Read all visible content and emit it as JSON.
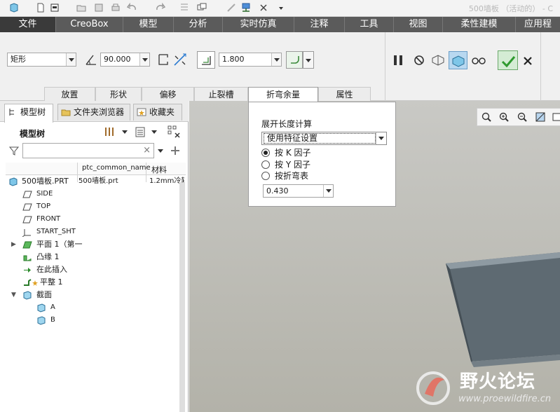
{
  "window": {
    "title": "500墙板 （活动的） - C"
  },
  "ribbon_tabs": [
    "文件",
    "CreoBox",
    "模型",
    "分析",
    "实时仿真",
    "注释",
    "工具",
    "视图",
    "柔性建模",
    "应用程"
  ],
  "toolbar": {
    "shape_select": "矩形",
    "angle_value": "90.000",
    "thickness_value": "1.800",
    "subtabs": [
      "放置",
      "形状",
      "偏移",
      "止裂槽",
      "折弯余量",
      "属性"
    ]
  },
  "left_panel": {
    "tabs": [
      "模型树",
      "文件夹浏览器",
      "收藏夹"
    ],
    "title": "模型树",
    "filter_clear": "×",
    "columns": [
      "ptc_common_name",
      "材料"
    ],
    "rows": [
      {
        "label": "500墙板.PRT",
        "name": "500墙板.prt",
        "material": "1.2mm冷轧",
        "expander": ""
      },
      {
        "label": "SIDE",
        "name": "",
        "material": "",
        "expander": ""
      },
      {
        "label": "TOP",
        "name": "",
        "material": "",
        "expander": ""
      },
      {
        "label": "FRONT",
        "name": "",
        "material": "",
        "expander": ""
      },
      {
        "label": "START_SHT",
        "name": "",
        "material": "",
        "expander": ""
      },
      {
        "label": "平面 1（第一",
        "name": "",
        "material": "",
        "expander": "▶"
      },
      {
        "label": "凸缘 1",
        "name": "",
        "material": "",
        "expander": ""
      },
      {
        "label": "在此插入",
        "name": "",
        "material": "",
        "expander": ""
      },
      {
        "label": "平整 1",
        "name": "",
        "material": "",
        "expander": ""
      },
      {
        "label": "截面",
        "name": "",
        "material": "",
        "expander": "▼"
      },
      {
        "label": "A",
        "name": "",
        "material": "",
        "expander": ""
      },
      {
        "label": "B",
        "name": "",
        "material": "",
        "expander": ""
      }
    ]
  },
  "bend_allowance_panel": {
    "title": "展开长度计算",
    "method": "使用特征设置",
    "options": [
      "按 K 因子",
      "按 Y 因子",
      "按折弯表"
    ],
    "selected_option": "按 K 因子",
    "k_value": "0.430"
  },
  "watermark": {
    "text": "野火论坛",
    "url": "www.proewildfire.cn"
  },
  "colors": {
    "ribbon_tab_bg": "#5b5b5b",
    "active_tab_bg": "#3a3a3a",
    "accept_green": "#3aa83a",
    "part_face": "#5c6870"
  }
}
